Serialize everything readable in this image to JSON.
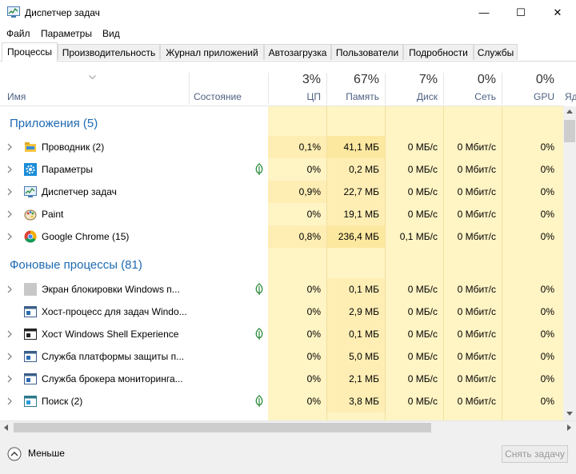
{
  "window": {
    "title": "Диспетчер задач",
    "minimize": "—",
    "maximize": "☐",
    "close": "✕"
  },
  "menu": [
    "Файл",
    "Параметры",
    "Вид"
  ],
  "tabs": [
    "Процессы",
    "Производительность",
    "Журнал приложений",
    "Автозагрузка",
    "Пользователи",
    "Подробности",
    "Службы"
  ],
  "columns": {
    "name": "Имя",
    "status": "Состояние",
    "cpu": {
      "pct": "3%",
      "label": "ЦП"
    },
    "mem": {
      "pct": "67%",
      "label": "Память"
    },
    "disk": {
      "pct": "7%",
      "label": "Диск"
    },
    "net": {
      "pct": "0%",
      "label": "Сеть"
    },
    "gpu": {
      "pct": "0%",
      "label": "GPU"
    },
    "extra": "Яд"
  },
  "groups": {
    "apps": "Приложения (5)",
    "background": "Фоновые процессы (81)"
  },
  "apps": [
    {
      "name": "Проводник (2)",
      "icon": "folder-icon",
      "cpu": "0,1%",
      "mem": "41,1 МБ",
      "disk": "0 МБ/с",
      "net": "0 Мбит/с",
      "gpu": "0%",
      "suspended": false,
      "expandable": true
    },
    {
      "name": "Параметры",
      "icon": "gear-icon",
      "cpu": "0%",
      "mem": "0,2 МБ",
      "disk": "0 МБ/с",
      "net": "0 Мбит/с",
      "gpu": "0%",
      "suspended": true,
      "expandable": true
    },
    {
      "name": "Диспетчер задач",
      "icon": "task-manager-icon",
      "cpu": "0,9%",
      "mem": "22,7 МБ",
      "disk": "0 МБ/с",
      "net": "0 Мбит/с",
      "gpu": "0%",
      "suspended": false,
      "expandable": true
    },
    {
      "name": "Paint",
      "icon": "paint-palette-icon",
      "cpu": "0%",
      "mem": "19,1 МБ",
      "disk": "0 МБ/с",
      "net": "0 Мбит/с",
      "gpu": "0%",
      "suspended": false,
      "expandable": true
    },
    {
      "name": "Google Chrome (15)",
      "icon": "chrome-icon",
      "cpu": "0,8%",
      "mem": "236,4 МБ",
      "disk": "0,1 МБ/с",
      "net": "0 Мбит/с",
      "gpu": "0%",
      "suspended": false,
      "expandable": true
    }
  ],
  "background": [
    {
      "name": "Экран блокировки Windows п...",
      "icon": "lockscreen-icon",
      "cpu": "0%",
      "mem": "0,1 МБ",
      "disk": "0 МБ/с",
      "net": "0 Мбит/с",
      "gpu": "0%",
      "suspended": true,
      "expandable": true
    },
    {
      "name": "Хост-процесс для задач Windo...",
      "icon": "window-app-icon",
      "cpu": "0%",
      "mem": "2,9 МБ",
      "disk": "0 МБ/с",
      "net": "0 Мбит/с",
      "gpu": "0%",
      "suspended": false,
      "expandable": false
    },
    {
      "name": "Хост Windows Shell Experience",
      "icon": "shell-icon",
      "cpu": "0%",
      "mem": "0,1 МБ",
      "disk": "0 МБ/с",
      "net": "0 Мбит/с",
      "gpu": "0%",
      "suspended": true,
      "expandable": true
    },
    {
      "name": "Служба платформы защиты п...",
      "icon": "window-app-icon",
      "cpu": "0%",
      "mem": "5,0 МБ",
      "disk": "0 МБ/с",
      "net": "0 Мбит/с",
      "gpu": "0%",
      "suspended": false,
      "expandable": true
    },
    {
      "name": "Служба брокера мониторинга...",
      "icon": "window-app-icon",
      "cpu": "0%",
      "mem": "2,1 МБ",
      "disk": "0 МБ/с",
      "net": "0 Мбит/с",
      "gpu": "0%",
      "suspended": false,
      "expandable": true
    },
    {
      "name": "Поиск (2)",
      "icon": "search-app-icon",
      "cpu": "0%",
      "mem": "3,8 МБ",
      "disk": "0 МБ/с",
      "net": "0 Мбит/с",
      "gpu": "0%",
      "suspended": true,
      "expandable": true
    }
  ],
  "footer": {
    "less": "Меньше",
    "end_task": "Снять задачу"
  },
  "colors": {
    "heat_light": "#fff4c4",
    "heat_mid": "#ffe8a8",
    "heat_strong": "#f9ecb0",
    "group": "#1e6ab3",
    "header_label": "#4d6082"
  }
}
